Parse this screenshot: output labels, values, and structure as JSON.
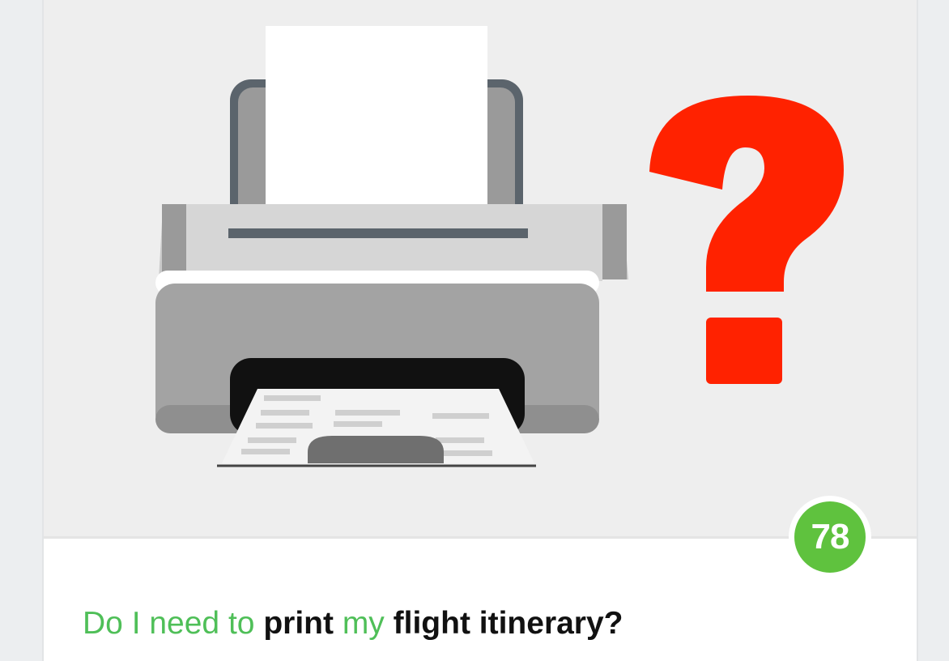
{
  "article": {
    "image_icon": "printer-with-question-mark",
    "score": "78",
    "title_parts": [
      {
        "text": "Do I need to ",
        "style": "highlight"
      },
      {
        "text": "print ",
        "style": "keyword"
      },
      {
        "text": "my ",
        "style": "highlight"
      },
      {
        "text": "flight itinerary?",
        "style": "keyword"
      }
    ]
  },
  "colors": {
    "highlight": "#4fbf58",
    "keyword": "#111111",
    "score_badge": "#5fc23e",
    "question_mark": "#ff2200"
  }
}
